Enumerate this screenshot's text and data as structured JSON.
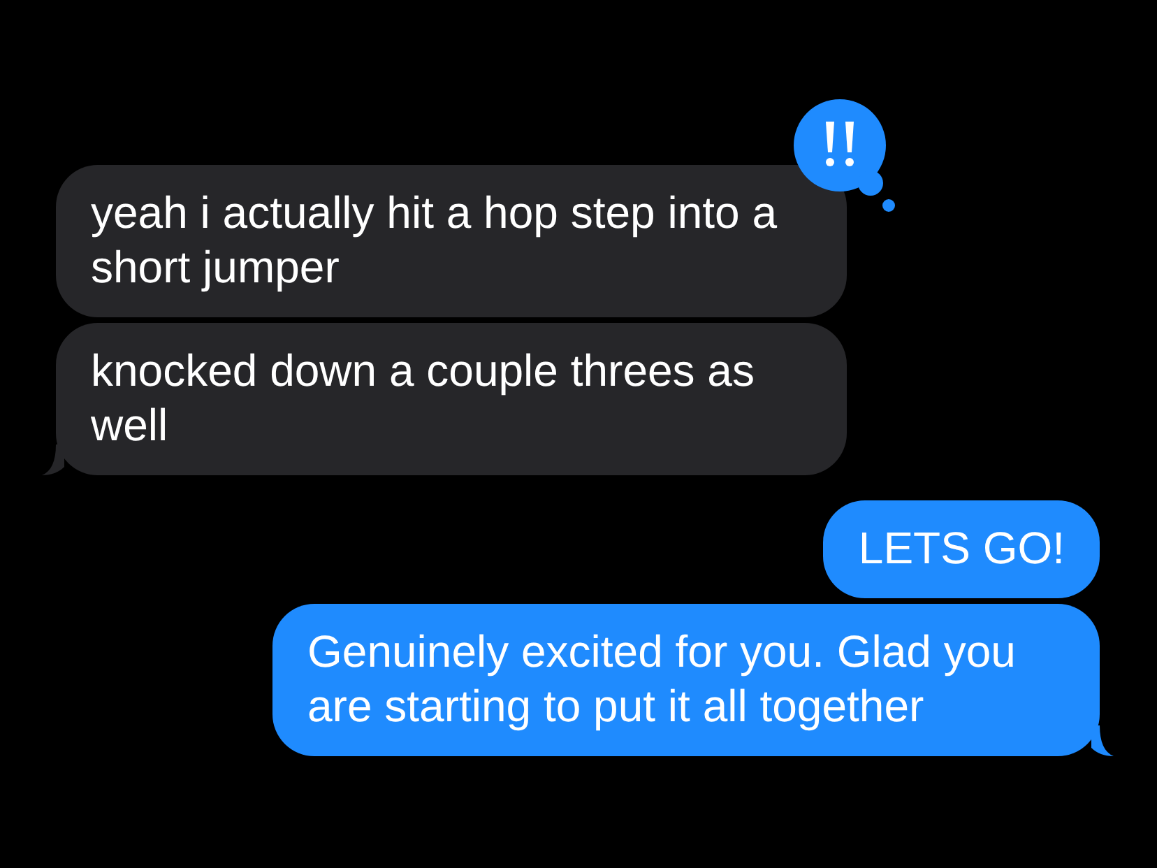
{
  "messages": [
    {
      "kind": "received",
      "text": "yeah i actually hit a hop step into a short jumper",
      "tail": false,
      "emphasized": true
    },
    {
      "kind": "received",
      "text": "knocked down a couple threes as well",
      "tail": true,
      "emphasized": false
    },
    {
      "kind": "sent",
      "text": "LETS GO!",
      "tail": false,
      "emphasized": false
    },
    {
      "kind": "sent",
      "text": "Genuinely excited for you. Glad you are starting to put it all together",
      "tail": true,
      "emphasized": false
    }
  ]
}
